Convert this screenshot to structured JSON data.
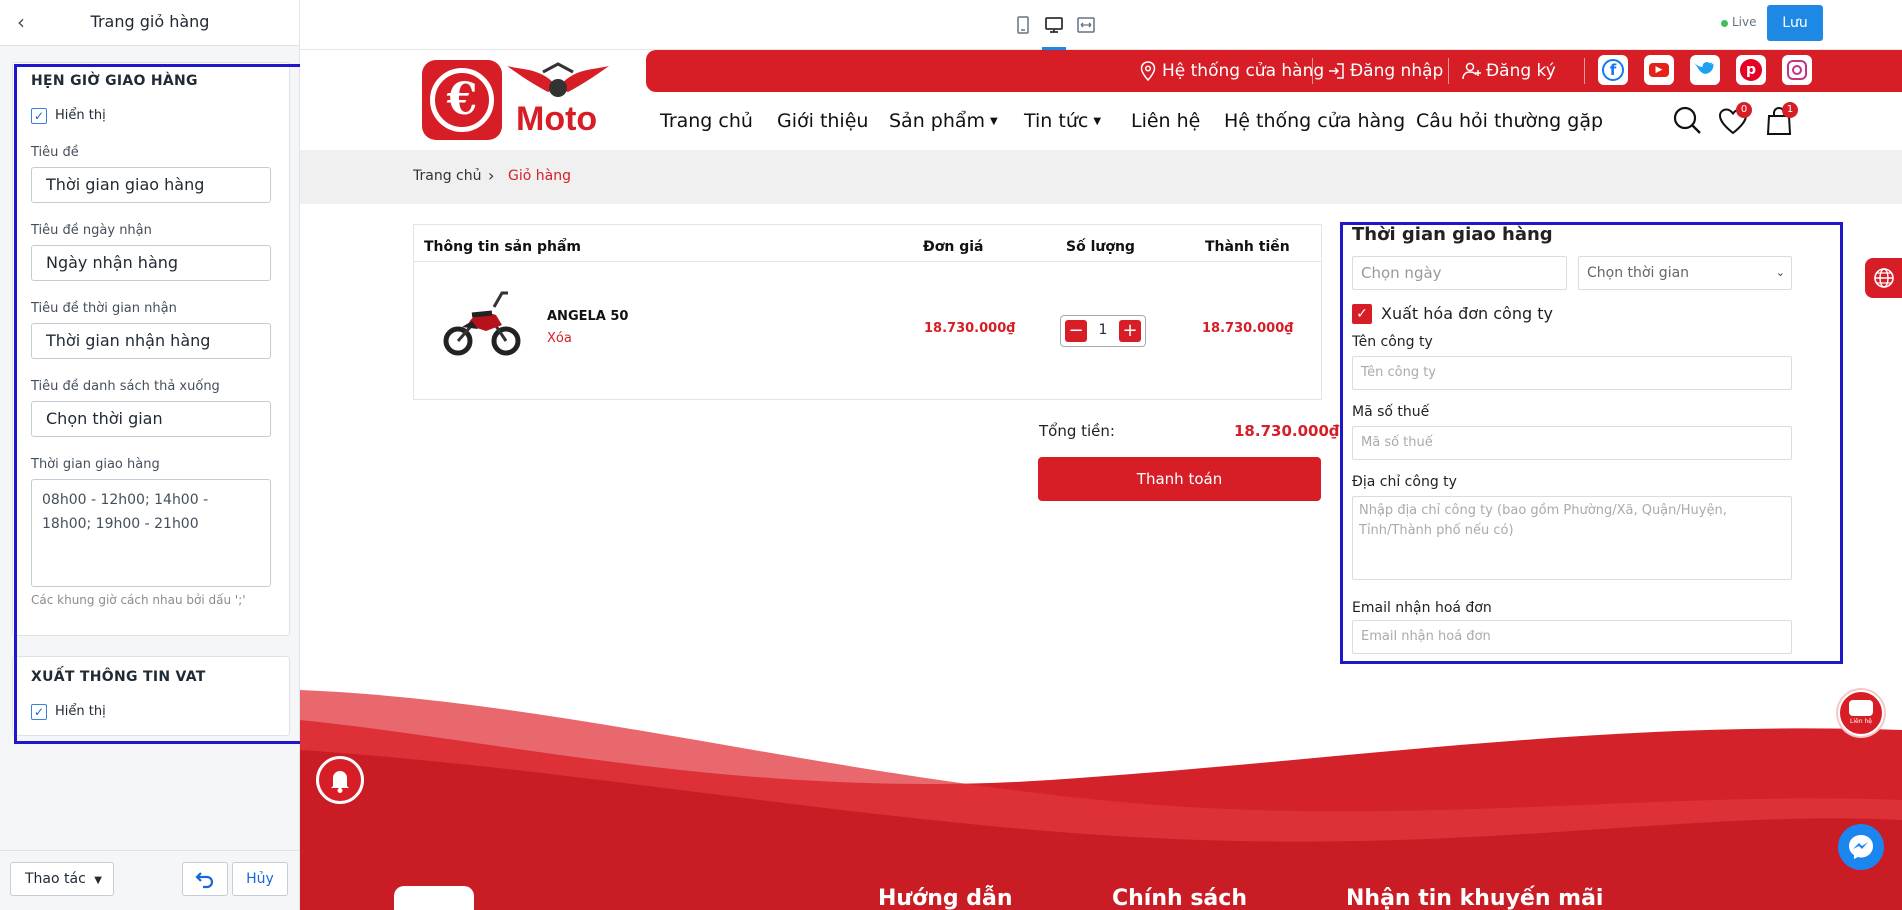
{
  "sidebar": {
    "title": "Trang giỏ hàng",
    "section1": {
      "heading": "HẸN GIỜ GIAO HÀNG",
      "show_label": "Hiển thị",
      "fields": [
        {
          "label": "Tiêu đề",
          "value": "Thời gian giao hàng"
        },
        {
          "label": "Tiêu đề ngày nhận",
          "value": "Ngày nhận hàng"
        },
        {
          "label": "Tiêu đề thời gian nhận",
          "value": "Thời gian nhận hàng"
        },
        {
          "label": "Tiêu đề danh sách thả xuống",
          "value": "Chọn thời gian"
        }
      ],
      "slots_label": "Thời gian giao hàng",
      "slots_value": "08h00 - 12h00; 14h00 - 18h00; 19h00 - 21h00",
      "slots_hint": "Các khung giờ cách nhau bởi dấu ';'"
    },
    "section2": {
      "heading": "XUẤT THÔNG TIN VAT",
      "show_label": "Hiển thị"
    },
    "footer": {
      "actions_label": "Thao tác",
      "cancel_label": "Hủy"
    }
  },
  "topbar": {
    "live_label": "Live",
    "save_label": "Lưu"
  },
  "site": {
    "logo_text": "Moto",
    "toplinks": [
      "Hệ thống cửa hàng",
      "Đăng nhập",
      "Đăng ký"
    ],
    "nav": [
      "Trang chủ",
      "Giới thiệu",
      "Sản phẩm",
      "Tin tức",
      "Liên hệ",
      "Hệ thống cửa hàng",
      "Câu hỏi thường gặp"
    ],
    "wishlist_count": "0",
    "cart_count": "1",
    "breadcrumb": {
      "home": "Trang chủ",
      "current": "Giỏ hàng"
    },
    "cart": {
      "headers": [
        "Thông tin sản phẩm",
        "Đơn giá",
        "Số lượng",
        "Thành tiền"
      ],
      "item": {
        "name": "ANGELA 50",
        "remove": "Xóa",
        "price": "18.730.000₫",
        "qty": "1",
        "total": "18.730.000₫"
      },
      "total_label": "Tổng tiền:",
      "total_value": "18.730.000₫",
      "checkout": "Thanh toán"
    },
    "delivery": {
      "title": "Thời gian giao hàng",
      "date_placeholder": "Chọn ngày",
      "time_select": "Chọn thời gian",
      "invoice_label": "Xuất hóa đơn công ty",
      "company_label": "Tên công ty",
      "company_placeholder": "Tên công ty",
      "tax_label": "Mã số thuế",
      "tax_placeholder": "Mã số thuế",
      "address_label": "Địa chỉ công ty",
      "address_placeholder": "Nhập địa chỉ công ty (bao gồm Phường/Xã, Quận/Huyện, Tỉnh/Thành phố nếu có)",
      "email_label": "Email nhận hoá đơn",
      "email_placeholder": "Email nhận hoá đơn"
    },
    "contact_widget": "Liên hệ",
    "footer_headings": [
      "Hướng dẫn",
      "Chính sách",
      "Nhận tin khuyến mãi"
    ]
  },
  "colors": {
    "brand_red": "#d71e27",
    "save_blue": "#1e88e5",
    "highlight_blue": "#1f17c9"
  }
}
